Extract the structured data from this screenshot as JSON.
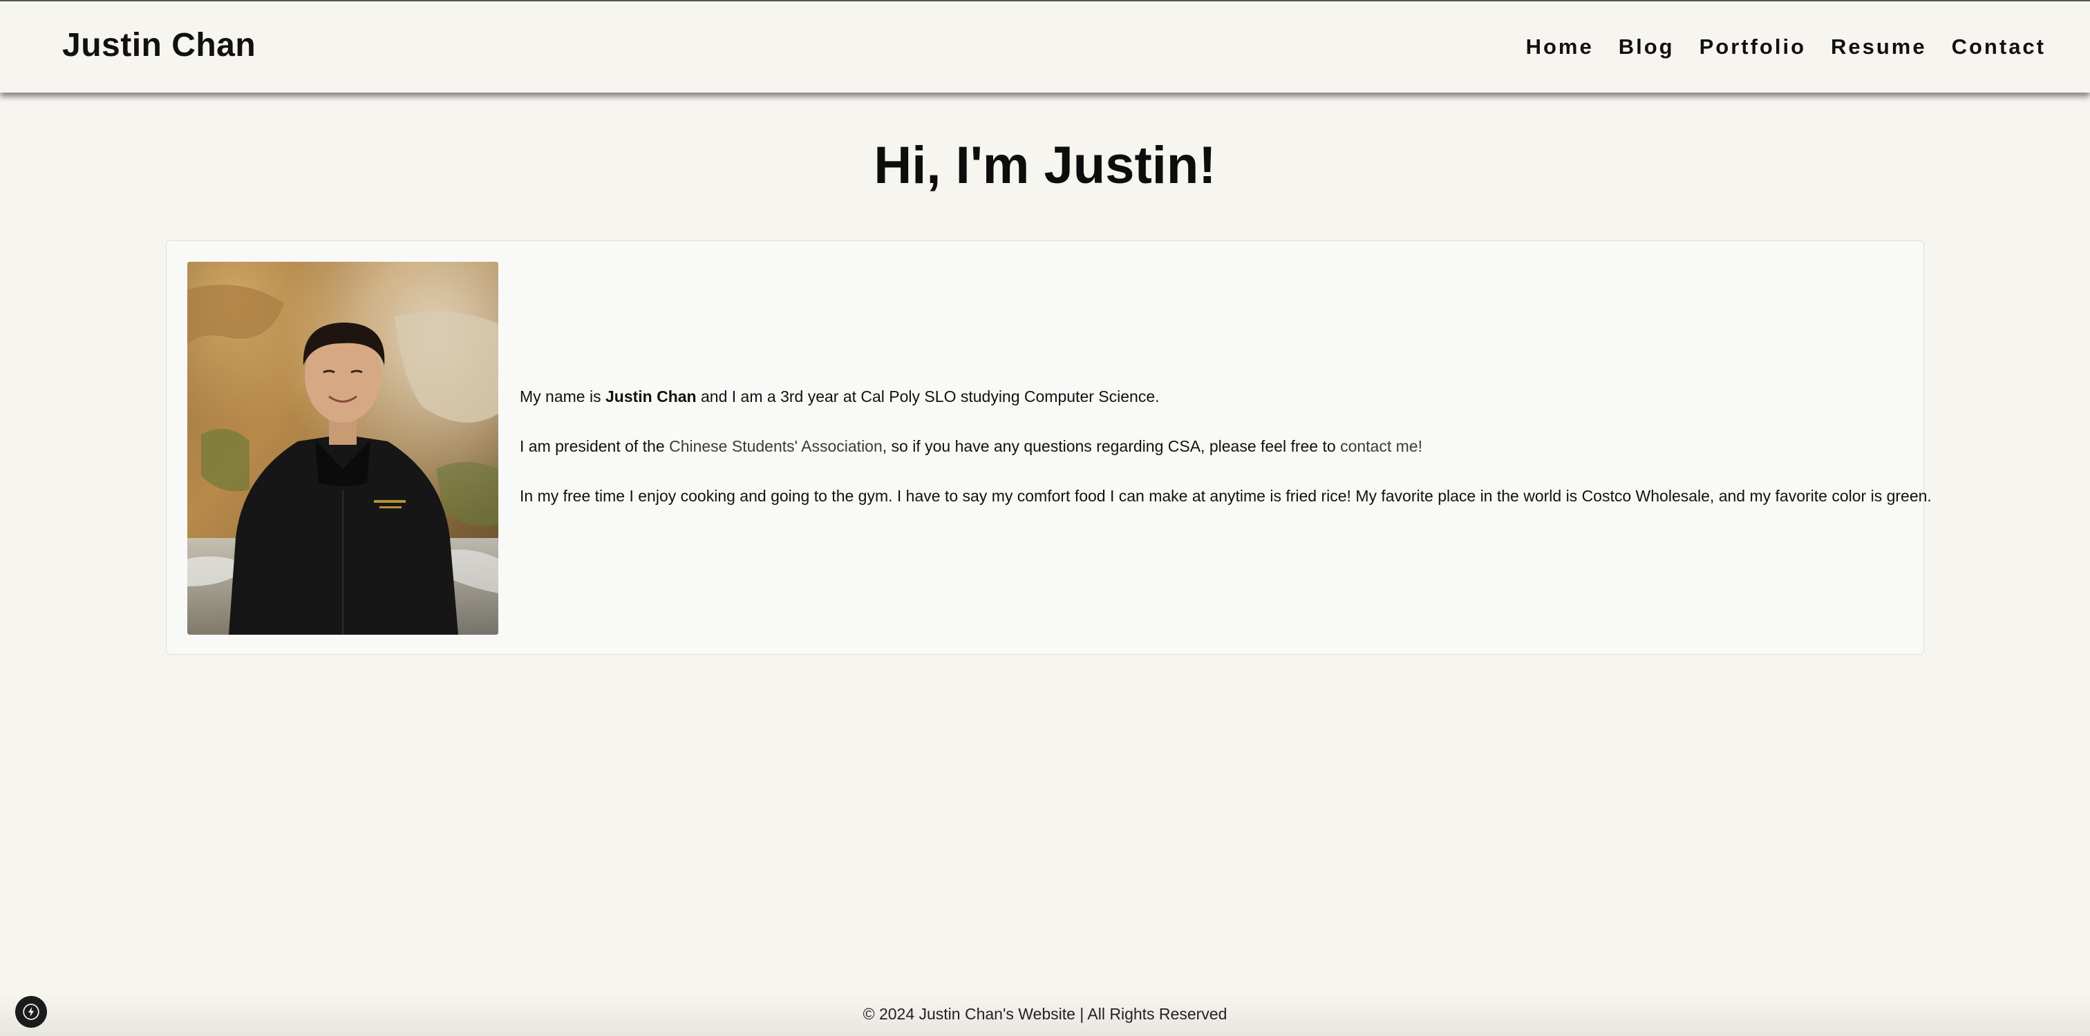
{
  "header": {
    "brand": "Justin Chan",
    "nav": [
      {
        "label": "Home"
      },
      {
        "label": "Blog"
      },
      {
        "label": "Portfolio"
      },
      {
        "label": "Resume"
      },
      {
        "label": "Contact"
      }
    ]
  },
  "main": {
    "title": "Hi, I'm Justin!",
    "bio": {
      "p1_prefix": "My name is ",
      "p1_name": "Justin Chan",
      "p1_suffix": " and I am a 3rd year at Cal Poly SLO studying Computer Science.",
      "p2_prefix": "I am president of the ",
      "p2_link": "Chinese Students' Association",
      "p2_middle": ", so if you have any questions regarding CSA, please feel free to ",
      "p2_contact": "contact me!",
      "p3": "In my free time I enjoy cooking and going to the gym. I have to say my comfort food I can make at anytime is fried rice! My favorite place in the world is Costco Wholesale, and my favorite color is green."
    },
    "photo_alt": "Justin Chan"
  },
  "footer": {
    "text": "© 2024 Justin Chan's Website | All Rights Reserved"
  },
  "icons": {
    "dev_badge": "lightning-bolt-icon"
  },
  "colors": {
    "background": "#f6f5f0",
    "card": "#f9f9f8",
    "text": "#111111",
    "link": "#3b3b3b"
  }
}
